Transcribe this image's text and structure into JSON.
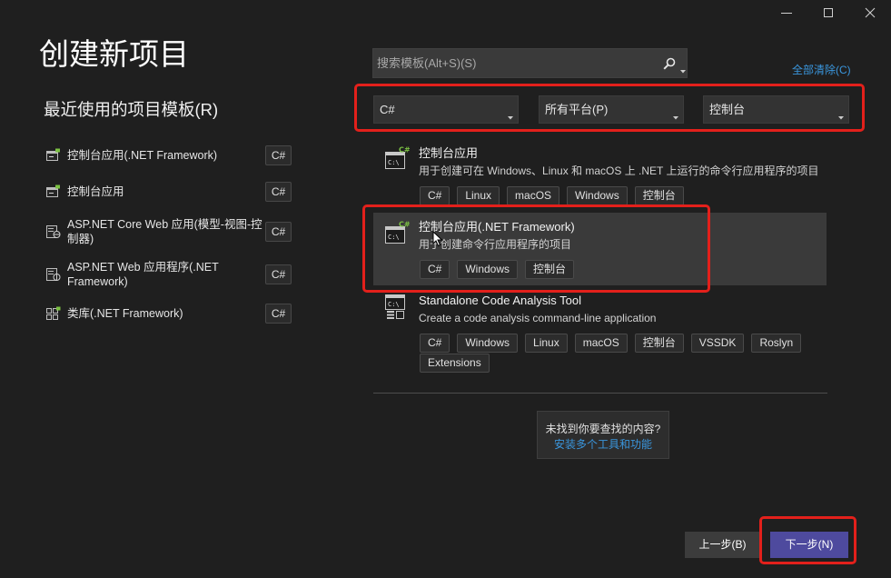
{
  "window_controls": {
    "minimize": "minimize-icon",
    "maximize": "maximize-icon",
    "close": "close-icon"
  },
  "page_title": "创建新项目",
  "recent": {
    "heading": "最近使用的项目模板(R)",
    "items": [
      {
        "icon": "console-app-icon",
        "lines": [
          "控制台应用(.NET Framework)"
        ],
        "language": "C#"
      },
      {
        "icon": "console-app-icon",
        "lines": [
          "控制台应用"
        ],
        "language": "C#"
      },
      {
        "icon": "aspnet-core-web-icon",
        "lines": [
          "ASP.NET Core Web 应用(模型-视图-控",
          "制器)"
        ],
        "language": "C#"
      },
      {
        "icon": "aspnet-web-icon",
        "lines": [
          "ASP.NET Web 应用程序(.NET",
          "Framework)"
        ],
        "language": "C#"
      },
      {
        "icon": "class-library-icon",
        "lines": [
          "类库(.NET Framework)"
        ],
        "language": "C#"
      }
    ]
  },
  "search": {
    "placeholder": "搜索模板(Alt+S)(S)",
    "icon": "search-icon",
    "options_icon": "chevron-down-icon"
  },
  "clear_all": "全部清除(C)",
  "filters": [
    {
      "label": "C#",
      "icon": "chevron-down-icon"
    },
    {
      "label": "所有平台(P)",
      "icon": "chevron-down-icon"
    },
    {
      "label": "控制台",
      "icon": "chevron-down-icon"
    }
  ],
  "templates": [
    {
      "icon": "console-app-csharp-icon",
      "selected": false,
      "title": "控制台应用",
      "description": "用于创建可在 Windows、Linux 和 macOS 上 .NET 上运行的命令行应用程序的项目",
      "tags": [
        "C#",
        "Linux",
        "macOS",
        "Windows",
        "控制台"
      ]
    },
    {
      "icon": "console-app-csharp-icon",
      "selected": true,
      "title": "控制台应用(.NET Framework)",
      "description": "用于创建命令行应用程序的项目",
      "tags": [
        "C#",
        "Windows",
        "控制台"
      ]
    },
    {
      "icon": "code-analysis-tool-icon",
      "selected": false,
      "title": "Standalone Code Analysis Tool",
      "description": "Create a code analysis command-line application",
      "tags": [
        "C#",
        "Windows",
        "Linux",
        "macOS",
        "控制台",
        "VSSDK",
        "Roslyn",
        "Extensions"
      ]
    }
  ],
  "help": {
    "question": "未找到你要查找的内容?",
    "link": "安装多个工具和功能"
  },
  "buttons": {
    "back": "上一步(B)",
    "next": "下一步(N)"
  },
  "icon_text": {
    "console_prompt": "C:\\",
    "language_badge": "C#"
  },
  "colors": {
    "background": "#1f1f1f",
    "selected_row": "#3a3a3a",
    "accent": "#4e4a9e",
    "link": "#3a96dd",
    "highlight": "#e3201b",
    "language_badge": "#7cc243"
  }
}
